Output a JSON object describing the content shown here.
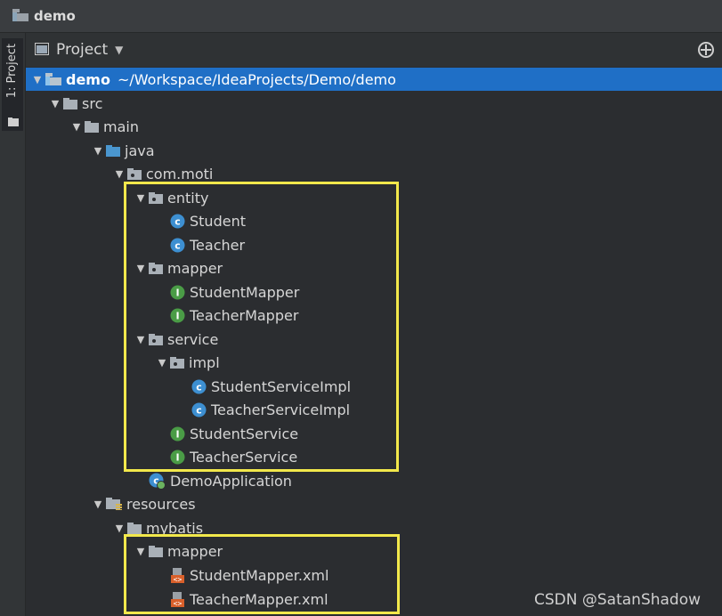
{
  "window": {
    "title": "demo"
  },
  "sidebar": {
    "tab_label": "1: Project"
  },
  "panel": {
    "title": "Project"
  },
  "tree": {
    "root": {
      "name": "demo",
      "path": "~/Workspace/IdeaProjects/Demo/demo"
    },
    "items": [
      {
        "label": "src"
      },
      {
        "label": "main"
      },
      {
        "label": "java"
      },
      {
        "label": "com.moti"
      },
      {
        "label": "entity"
      },
      {
        "label": "Student"
      },
      {
        "label": "Teacher"
      },
      {
        "label": "mapper"
      },
      {
        "label": "StudentMapper"
      },
      {
        "label": "TeacherMapper"
      },
      {
        "label": "service"
      },
      {
        "label": "impl"
      },
      {
        "label": "StudentServiceImpl"
      },
      {
        "label": "TeacherServiceImpl"
      },
      {
        "label": "StudentService"
      },
      {
        "label": "TeacherService"
      },
      {
        "label": "DemoApplication"
      },
      {
        "label": "resources"
      },
      {
        "label": "mybatis"
      },
      {
        "label": "mapper"
      },
      {
        "label": "StudentMapper.xml"
      },
      {
        "label": "TeacherMapper.xml"
      }
    ]
  },
  "watermark": "CSDN @SatanShadow",
  "colors": {
    "selection": "#1f6fc6",
    "highlight_box": "#f2e84b",
    "class_icon": "#3d8fd1",
    "interface_icon": "#4a9c46",
    "xml_icon": "#d9602b"
  }
}
